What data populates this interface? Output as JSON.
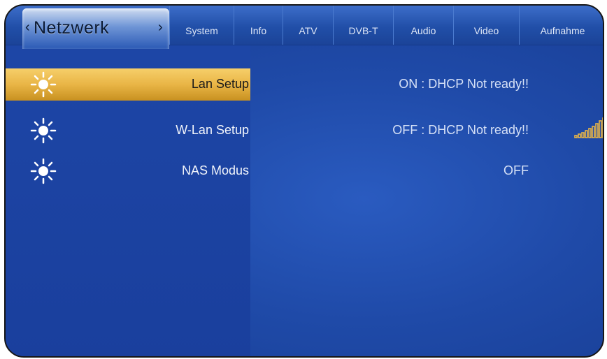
{
  "tabs": {
    "active": "Netzwerk",
    "items": [
      {
        "label": "System"
      },
      {
        "label": "Info"
      },
      {
        "label": "ATV"
      },
      {
        "label": "DVB-T"
      },
      {
        "label": "Audio"
      },
      {
        "label": "Video"
      },
      {
        "label": "Aufnahme"
      }
    ]
  },
  "rows": [
    {
      "label": "Lan Setup",
      "status": "ON : DHCP Not ready!!",
      "selected": true
    },
    {
      "label": "W-Lan Setup",
      "status": "OFF : DHCP Not ready!!",
      "selected": false
    },
    {
      "label": "NAS Modus",
      "status": "OFF",
      "selected": false
    }
  ],
  "icons": {
    "row": "sun-icon",
    "signal": "signal-strength-icon"
  },
  "colors": {
    "background": "#1f4aa8",
    "selected": "#e9b546"
  }
}
